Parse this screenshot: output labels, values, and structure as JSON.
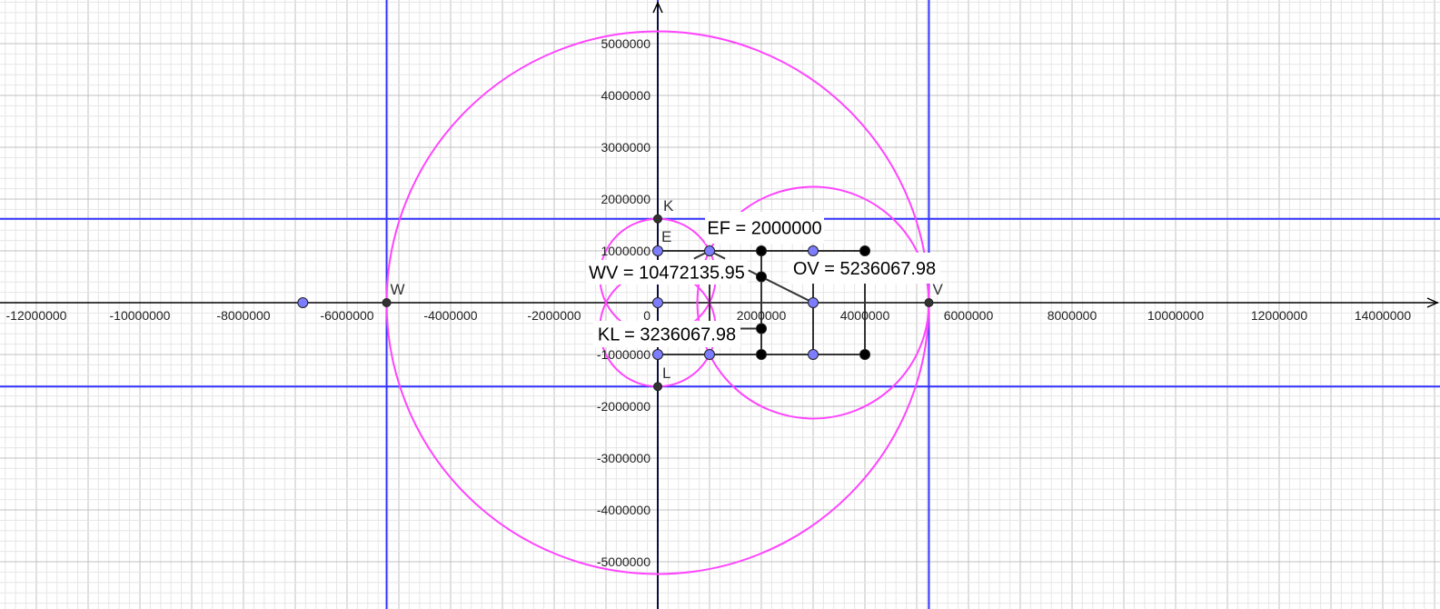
{
  "colors": {
    "grid_major": "#c0c0c0",
    "grid_minor": "#e6e6e6",
    "axis": "#000000",
    "blue_lines": "#3333ff",
    "circles": "#ff44ff",
    "segments": "#333333",
    "free_point": "#7d7dff",
    "dependent_point": "#000000",
    "intersection_point": "#333333"
  },
  "axes": {
    "origin_label": "0",
    "x_ticks": [
      {
        "value": -12000000,
        "label": "-12000000"
      },
      {
        "value": -10000000,
        "label": "-10000000"
      },
      {
        "value": -8000000,
        "label": "-8000000"
      },
      {
        "value": -6000000,
        "label": "-6000000"
      },
      {
        "value": -4000000,
        "label": "-4000000"
      },
      {
        "value": -2000000,
        "label": "-2000000"
      },
      {
        "value": 2000000,
        "label": "2000000"
      },
      {
        "value": 4000000,
        "label": "4000000"
      },
      {
        "value": 6000000,
        "label": "6000000"
      },
      {
        "value": 8000000,
        "label": "8000000"
      },
      {
        "value": 10000000,
        "label": "10000000"
      },
      {
        "value": 12000000,
        "label": "12000000"
      },
      {
        "value": 14000000,
        "label": "14000000"
      }
    ],
    "y_ticks": [
      {
        "value": 5000000,
        "label": "5000000"
      },
      {
        "value": 4000000,
        "label": "4000000"
      },
      {
        "value": 3000000,
        "label": "3000000"
      },
      {
        "value": 2000000,
        "label": "2000000"
      },
      {
        "value": 1000000,
        "label": "1000000"
      },
      {
        "value": -1000000,
        "label": "-1000000"
      },
      {
        "value": -2000000,
        "label": "-2000000"
      },
      {
        "value": -3000000,
        "label": "-3000000"
      },
      {
        "value": -4000000,
        "label": "-4000000"
      },
      {
        "value": -5000000,
        "label": "-5000000"
      }
    ]
  },
  "blue_lines": [
    {
      "orientation": "vertical",
      "value": -5236067.98
    },
    {
      "orientation": "vertical",
      "value": 0
    },
    {
      "orientation": "vertical",
      "value": 5236067.98
    },
    {
      "orientation": "horizontal",
      "value": 1618033.99
    },
    {
      "orientation": "horizontal",
      "value": -1618033.99
    }
  ],
  "circles": [
    {
      "cx": 0,
      "cy": 0,
      "r": 5236067.98
    },
    {
      "cx": 3000000,
      "cy": 0,
      "r": 2236067.98
    },
    {
      "cx": 0,
      "cy": 500000,
      "r": 1118033.99
    },
    {
      "cx": 0,
      "cy": -500000,
      "r": 1118033.99
    }
  ],
  "segments": [
    {
      "x1": 0,
      "y1": 1000000,
      "x2": 4000000,
      "y2": 1000000
    },
    {
      "x1": 0,
      "y1": -1000000,
      "x2": 4000000,
      "y2": -1000000
    },
    {
      "x1": 2000000,
      "y1": 1000000,
      "x2": 2000000,
      "y2": -1000000
    },
    {
      "x1": 3000000,
      "y1": 1000000,
      "x2": 3000000,
      "y2": -1000000
    },
    {
      "x1": 4000000,
      "y1": 1000000,
      "x2": 4000000,
      "y2": -1000000
    },
    {
      "x1": 1000000,
      "y1": 400000,
      "x2": 1000000,
      "y2": -400000
    },
    {
      "x1": 1750000,
      "y1": 625000,
      "x2": 3000000,
      "y2": 0
    },
    {
      "x1": 1000000,
      "y1": 1000000,
      "x2": 700000,
      "y2": 850000
    },
    {
      "x1": 1000000,
      "y1": 1000000,
      "x2": 1300000,
      "y2": 850000
    },
    {
      "x1": 1550000,
      "y1": -500000,
      "x2": 2000000,
      "y2": -500000
    }
  ],
  "points": [
    {
      "x": 0,
      "y": 1618033.99,
      "style": "intersection_point",
      "label": "K"
    },
    {
      "x": 0,
      "y": -1618033.99,
      "style": "intersection_point",
      "label": "L"
    },
    {
      "x": -5236067.98,
      "y": 0,
      "style": "intersection_point",
      "label": "W"
    },
    {
      "x": 5236067.98,
      "y": 0,
      "style": "intersection_point",
      "label": "V"
    },
    {
      "x": 0,
      "y": 1000000,
      "style": "free_point",
      "label": "E"
    },
    {
      "x": 1000000,
      "y": 1000000,
      "style": "free_point",
      "label": ""
    },
    {
      "x": 3000000,
      "y": 1000000,
      "style": "free_point",
      "label": ""
    },
    {
      "x": 0,
      "y": 0,
      "style": "free_point",
      "label": ""
    },
    {
      "x": 3000000,
      "y": 0,
      "style": "free_point",
      "label": ""
    },
    {
      "x": 0,
      "y": -1000000,
      "style": "free_point",
      "label": ""
    },
    {
      "x": 1000000,
      "y": -1000000,
      "style": "free_point",
      "label": ""
    },
    {
      "x": 3000000,
      "y": -1000000,
      "style": "free_point",
      "label": ""
    },
    {
      "x": -6854101.97,
      "y": 0,
      "style": "free_point",
      "label": ""
    },
    {
      "x": 2000000,
      "y": 1000000,
      "style": "dependent_point",
      "label": ""
    },
    {
      "x": 4000000,
      "y": 1000000,
      "style": "dependent_point",
      "label": ""
    },
    {
      "x": 2000000,
      "y": 500000,
      "style": "dependent_point",
      "label": ""
    },
    {
      "x": 2000000,
      "y": -500000,
      "style": "dependent_point",
      "label": ""
    },
    {
      "x": 2000000,
      "y": -1000000,
      "style": "dependent_point",
      "label": ""
    },
    {
      "x": 4000000,
      "y": -1000000,
      "style": "dependent_point",
      "label": ""
    }
  ],
  "captions": [
    {
      "id": "ef",
      "text": "EF = 2000000"
    },
    {
      "id": "wv",
      "text": "WV = 10472135.95"
    },
    {
      "id": "ov",
      "text": "OV = 5236067.98"
    },
    {
      "id": "kl",
      "text": "KL = 3236067.98"
    }
  ]
}
